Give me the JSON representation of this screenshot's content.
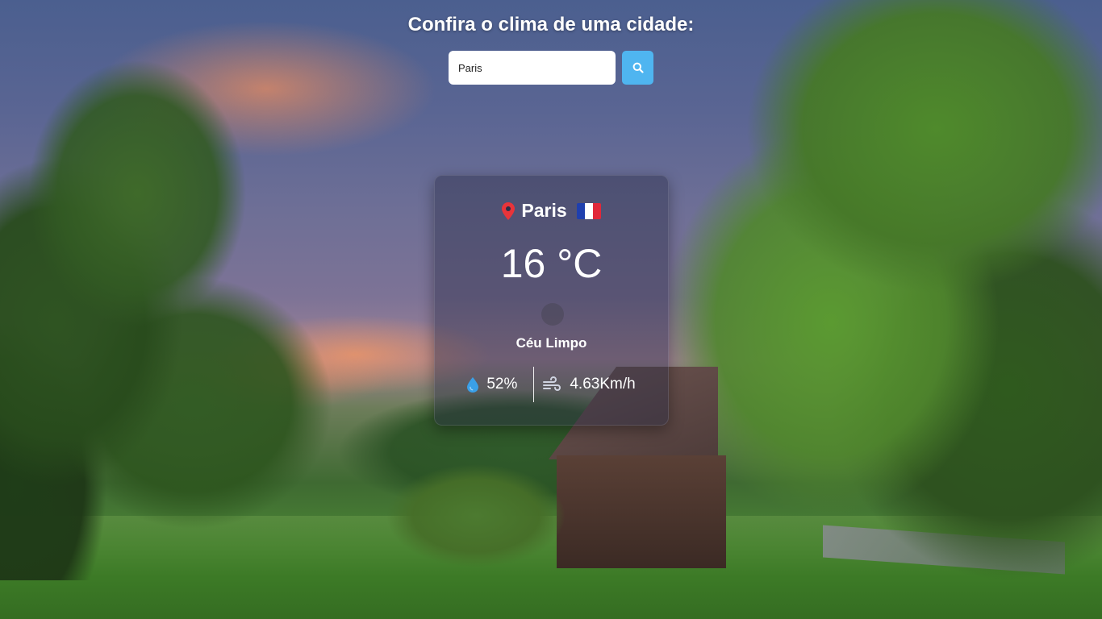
{
  "header": {
    "title": "Confira o clima de uma cidade:"
  },
  "search": {
    "value": "Paris",
    "button_icon": "search-icon"
  },
  "weather": {
    "city": "Paris",
    "location_icon": "map-pin-icon",
    "country_flag": "france-flag",
    "temperature": "16 °C",
    "description": "Céu Limpo",
    "humidity": "52%",
    "humidity_icon": "droplet-icon",
    "wind": "4.63Km/h",
    "wind_icon": "wind-icon"
  },
  "colors": {
    "search_button": "#4fb5f0",
    "location_pin": "#e8343a",
    "humidity_icon": "#3aa0e8",
    "flag_blue": "#1f3fae",
    "flag_white": "#ffffff",
    "flag_red": "#e1283a"
  }
}
